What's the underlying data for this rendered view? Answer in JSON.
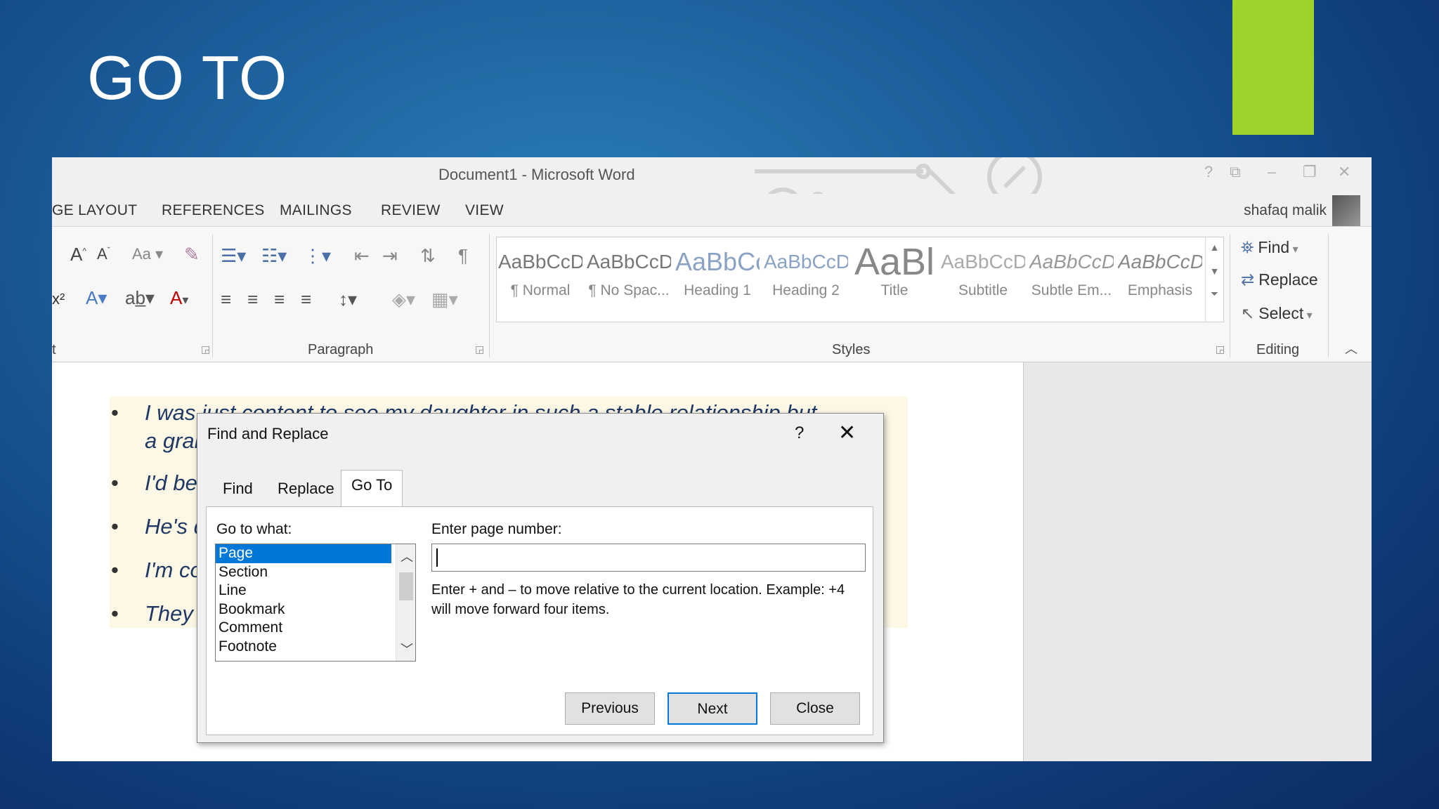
{
  "slide": {
    "title": "GO TO"
  },
  "word": {
    "window_title": "Document1 - Microsoft Word",
    "window_controls": [
      "?",
      "⧉",
      "–",
      "❐",
      "✕"
    ],
    "tabs": [
      "GE LAYOUT",
      "REFERENCES",
      "MAILINGS",
      "REVIEW",
      "VIEW"
    ],
    "user_name": "shafaq malik",
    "groups": {
      "font_partial": "t",
      "paragraph": "Paragraph",
      "styles": "Styles",
      "editing": "Editing"
    },
    "styles": [
      {
        "sample": "AaBbCcDc",
        "name": "¶ Normal"
      },
      {
        "sample": "AaBbCcDc",
        "name": "¶ No Spac..."
      },
      {
        "sample": "AaBbCc",
        "name": "Heading 1"
      },
      {
        "sample": "AaBbCcD",
        "name": "Heading 2"
      },
      {
        "sample": "AaBl",
        "name": "Title"
      },
      {
        "sample": "AaBbCcD",
        "name": "Subtitle"
      },
      {
        "sample": "AaBbCcDc",
        "name": "Subtle Em..."
      },
      {
        "sample": "AaBbCcDc",
        "name": "Emphasis"
      }
    ],
    "editing": {
      "find": "Find",
      "replace": "Replace",
      "select": "Select"
    },
    "document_lines": [
      "I was just content to see my daughter in such a stable relationship but",
      "a grar",
      "I'd be",
      "He's q",
      "I'm co",
      "They v"
    ]
  },
  "dialog": {
    "title": "Find and Replace",
    "help": "?",
    "close_glyph": "✕",
    "tabs": [
      "Find",
      "Replace",
      "Go To"
    ],
    "active_tab": "Go To",
    "go_to_what_label": "Go to what:",
    "go_to_items": [
      "Page",
      "Section",
      "Line",
      "Bookmark",
      "Comment",
      "Footnote"
    ],
    "selected_item": "Page",
    "page_number_label": "Enter page number:",
    "page_number_value": "",
    "hint": "Enter + and – to move relative to the current location. Example: +4 will move forward four items.",
    "buttons": {
      "previous": "Previous",
      "next": "Next",
      "close": "Close"
    }
  },
  "colors": {
    "accent_bar": "#9fd22a",
    "selection": "#0078d7",
    "doc_text": "#1f3864"
  }
}
